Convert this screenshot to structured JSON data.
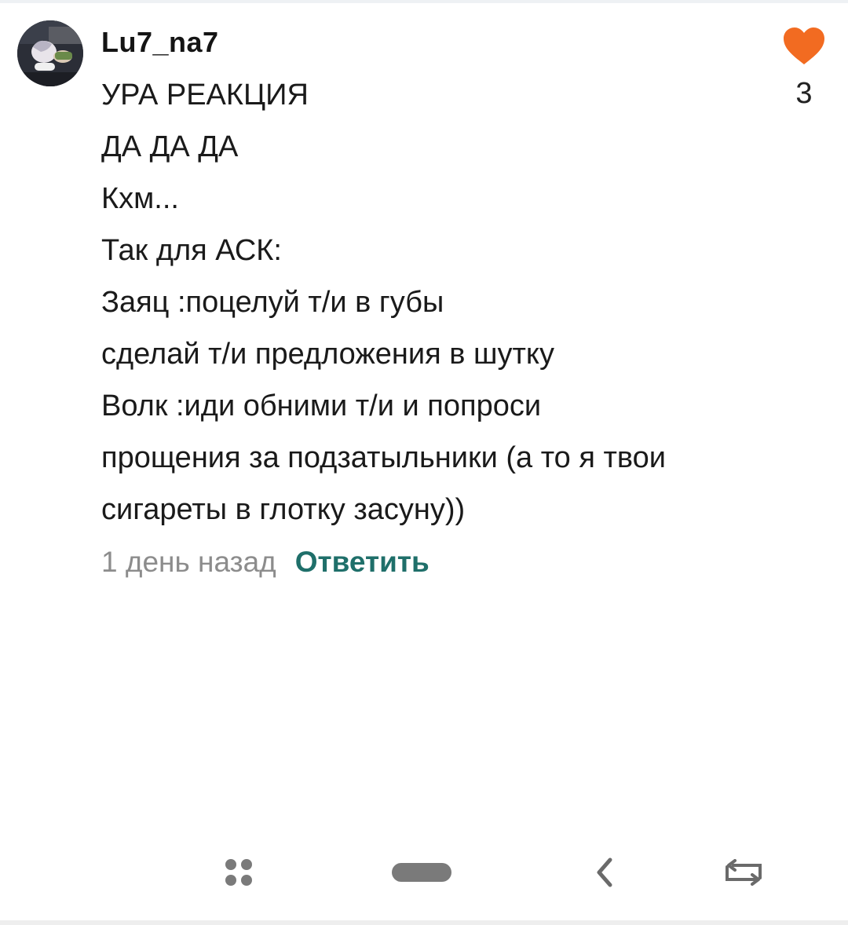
{
  "comment": {
    "username": "Lu7_na7",
    "avatar_icon": "anime-character-avatar",
    "lines": [
      "УРА РЕАКЦИЯ",
      "ДА ДА ДА",
      "Кхм...",
      "Так для АСК:",
      "Заяц :поцелуй т/и в губы",
      "сделай т/и предложения в шутку",
      "Волк :иди обними т/и и попроси",
      "прощения за подзатыльники (а то я твои",
      "сигареты в глотку засуну))"
    ],
    "timestamp": "1 день назад",
    "reply_label": "Ответить",
    "like_count": "3",
    "like_icon": "heart-icon",
    "like_color": "#f26b21",
    "reply_color": "#1f6f6a"
  },
  "navigation": {
    "buttons": [
      {
        "name": "menu-dots-icon"
      },
      {
        "name": "home-pill-icon"
      },
      {
        "name": "back-chevron-icon"
      },
      {
        "name": "recent-apps-icon"
      }
    ]
  }
}
